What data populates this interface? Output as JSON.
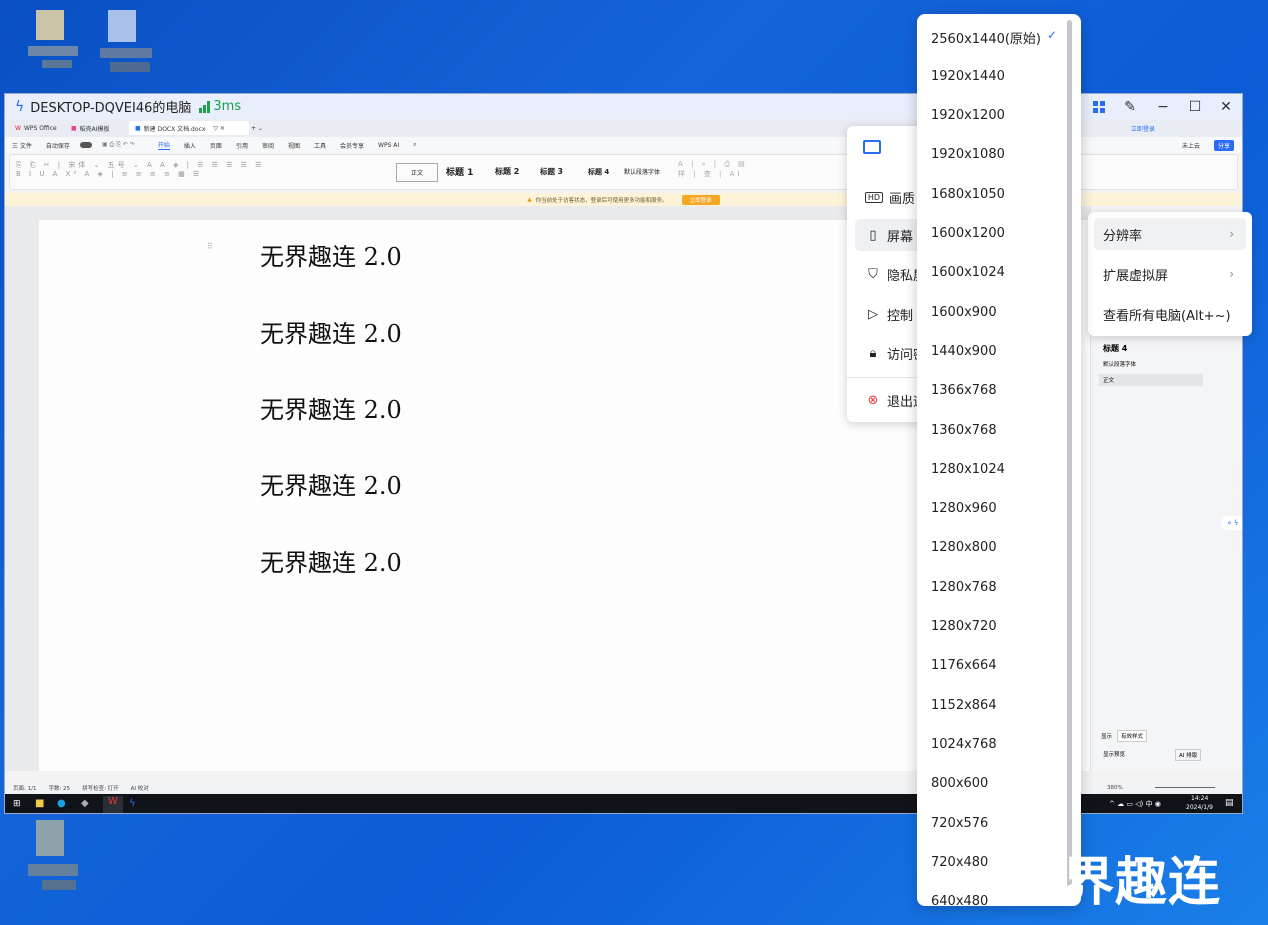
{
  "remote": {
    "title": "DESKTOP-DQVEI46的电脑",
    "latency": "3ms"
  },
  "wps": {
    "tabs": [
      "WPS Office",
      "稻壳AI模板",
      "新建 DOCX 文档.docx"
    ],
    "menu": [
      "三 文件",
      "自动保存",
      "开始",
      "插入",
      "页面",
      "引用",
      "审阅",
      "视图",
      "工具",
      "会员专享",
      "WPS AI"
    ],
    "styles": [
      "正文",
      "标题 1",
      "标题 2",
      "标题 3",
      "标题 4",
      "默认段落字体"
    ],
    "notice": "你当前处于访客状态，登录后可使用更多功能和服务。",
    "notice_btn": "立即登录",
    "login": "立即登录",
    "cloud": "未上云",
    "share": "分享",
    "status": [
      "页面: 1/1",
      "字数: 25",
      "拼写检查: 打开",
      "AI 校对"
    ],
    "zoom": "380%",
    "pane_styles": [
      "标题 4",
      "默认段落字体",
      "正文"
    ],
    "pane_bottom": [
      "显示",
      "有效样式",
      "显示预览",
      "AI 排版"
    ],
    "clock_time": "14:24",
    "clock_date": "2024/1/9"
  },
  "doc": {
    "lines": [
      "无界趣连 2.0",
      "无界趣连 2.0",
      "无界趣连 2.0",
      "无界趣连 2.0",
      "无界趣连 2.0"
    ]
  },
  "ctrl_menu": {
    "items": [
      "画质",
      "屏幕",
      "隐私屏",
      "控制",
      "访问密",
      "退出远"
    ]
  },
  "resolutions": {
    "selected": "2560x1440(原始)",
    "options": [
      "2560x1440(原始)",
      "1920x1440",
      "1920x1200",
      "1920x1080",
      "1680x1050",
      "1600x1200",
      "1600x1024",
      "1600x900",
      "1440x900",
      "1366x768",
      "1360x768",
      "1280x1024",
      "1280x960",
      "1280x800",
      "1280x768",
      "1280x720",
      "1176x664",
      "1152x864",
      "1024x768",
      "800x600",
      "720x576",
      "720x480",
      "640x480"
    ]
  },
  "screen_sub": {
    "items": [
      "分辨率",
      "扩展虚拟屏",
      "查看所有电脑(Alt+~)"
    ]
  },
  "watermark": "界趣连"
}
